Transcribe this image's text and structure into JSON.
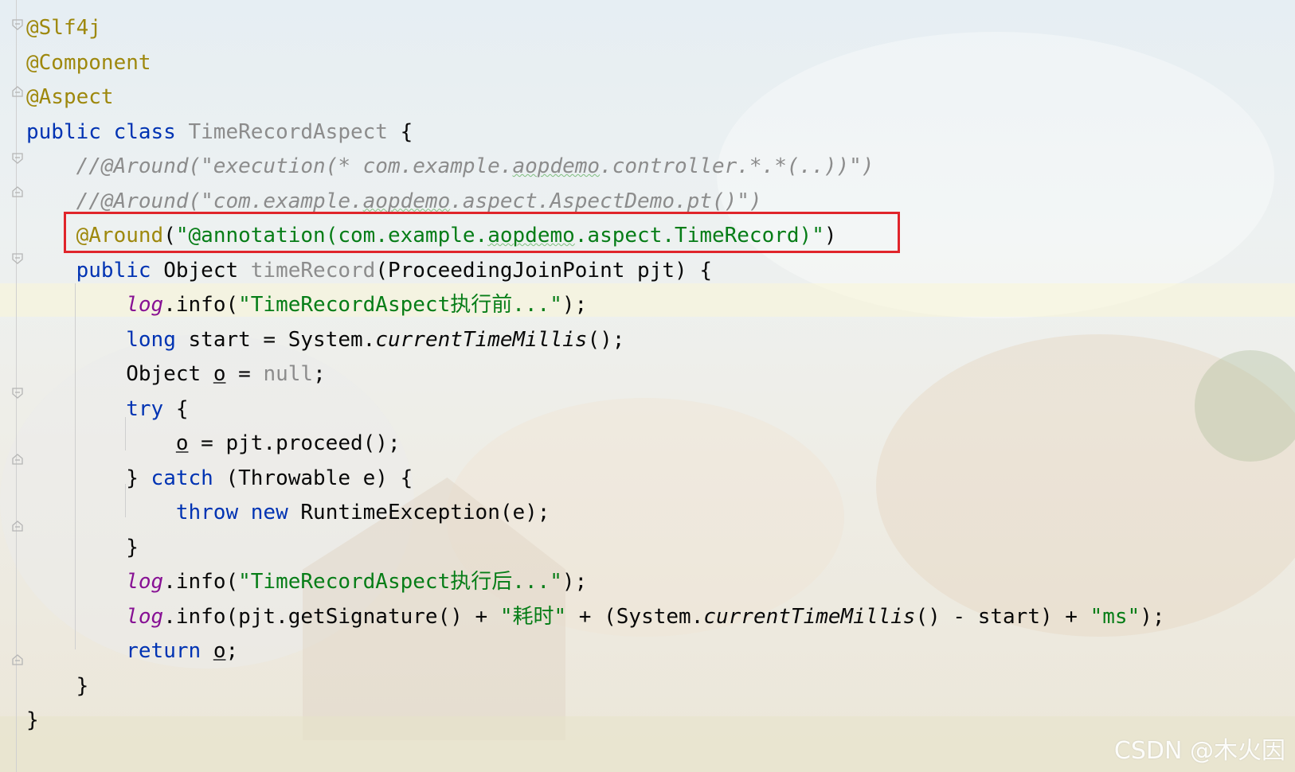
{
  "editor": {
    "lines": [
      [
        {
          "t": "@Slf4j",
          "c": "ann"
        }
      ],
      [
        {
          "t": "@Component",
          "c": "ann"
        }
      ],
      [
        {
          "t": "@Aspect",
          "c": "ann"
        }
      ],
      [
        {
          "t": "public class ",
          "c": "kw"
        },
        {
          "t": "TimeRecordAspect",
          "c": "gray"
        },
        {
          "t": " {",
          "c": ""
        }
      ],
      [
        {
          "t": "    ",
          "c": ""
        },
        {
          "t": "//@Around(\"execution(* com.example.",
          "c": "cmt"
        },
        {
          "t": "aopdemo",
          "c": "cmt wavy"
        },
        {
          "t": ".controller.*.*(..))\")",
          "c": "cmt"
        }
      ],
      [
        {
          "t": "    ",
          "c": ""
        },
        {
          "t": "//@Around(\"com.example.",
          "c": "cmt"
        },
        {
          "t": "aopdemo",
          "c": "cmt wavy"
        },
        {
          "t": ".aspect.AspectDemo.pt()\")",
          "c": "cmt"
        }
      ],
      [
        {
          "t": "    ",
          "c": ""
        },
        {
          "t": "@Around",
          "c": "ann"
        },
        {
          "t": "(",
          "c": ""
        },
        {
          "t": "\"@annotation(com.example.",
          "c": "str"
        },
        {
          "t": "aopdemo",
          "c": "str wavy"
        },
        {
          "t": ".aspect.TimeRecord)\"",
          "c": "str"
        },
        {
          "t": ")",
          "c": ""
        }
      ],
      [
        {
          "t": "    ",
          "c": ""
        },
        {
          "t": "public ",
          "c": "kw"
        },
        {
          "t": "Object ",
          "c": ""
        },
        {
          "t": "timeRecord",
          "c": "gray"
        },
        {
          "t": "(ProceedingJoinPoint pjt) {",
          "c": ""
        }
      ],
      [
        {
          "t": "        ",
          "c": ""
        },
        {
          "t": "log",
          "c": "fld"
        },
        {
          "t": ".info(",
          "c": ""
        },
        {
          "t": "\"TimeRecordAspect执行前...\"",
          "c": "str"
        },
        {
          "t": ");",
          "c": ""
        }
      ],
      [
        {
          "t": "        ",
          "c": ""
        },
        {
          "t": "long ",
          "c": "kw"
        },
        {
          "t": "start = System.",
          "c": ""
        },
        {
          "t": "currentTimeMillis",
          "c": "it"
        },
        {
          "t": "();",
          "c": ""
        }
      ],
      [
        {
          "t": "        Object ",
          "c": ""
        },
        {
          "t": "o",
          "c": "ul"
        },
        {
          "t": " = ",
          "c": ""
        },
        {
          "t": "null",
          "c": "gray"
        },
        {
          "t": ";",
          "c": ""
        }
      ],
      [
        {
          "t": "        ",
          "c": ""
        },
        {
          "t": "try ",
          "c": "kw"
        },
        {
          "t": "{",
          "c": ""
        }
      ],
      [
        {
          "t": "            ",
          "c": ""
        },
        {
          "t": "o",
          "c": "ul"
        },
        {
          "t": " = pjt.proceed();",
          "c": ""
        }
      ],
      [
        {
          "t": "        } ",
          "c": ""
        },
        {
          "t": "catch ",
          "c": "kw"
        },
        {
          "t": "(Throwable e) {",
          "c": ""
        }
      ],
      [
        {
          "t": "            ",
          "c": ""
        },
        {
          "t": "throw new ",
          "c": "kw"
        },
        {
          "t": "RuntimeException(e);",
          "c": ""
        }
      ],
      [
        {
          "t": "        }",
          "c": ""
        }
      ],
      [
        {
          "t": "        ",
          "c": ""
        },
        {
          "t": "log",
          "c": "fld"
        },
        {
          "t": ".info(",
          "c": ""
        },
        {
          "t": "\"TimeRecordAspect执行后...\"",
          "c": "str"
        },
        {
          "t": ");",
          "c": ""
        }
      ],
      [
        {
          "t": "        ",
          "c": ""
        },
        {
          "t": "log",
          "c": "fld"
        },
        {
          "t": ".info(pjt.getSignature() + ",
          "c": ""
        },
        {
          "t": "\"耗时\"",
          "c": "str"
        },
        {
          "t": " + (System.",
          "c": ""
        },
        {
          "t": "currentTimeMillis",
          "c": "it"
        },
        {
          "t": "() - start) + ",
          "c": ""
        },
        {
          "t": "\"ms\"",
          "c": "str"
        },
        {
          "t": ");",
          "c": ""
        }
      ],
      [
        {
          "t": "        ",
          "c": ""
        },
        {
          "t": "return ",
          "c": "kw"
        },
        {
          "t": "o",
          "c": "ul"
        },
        {
          "t": ";",
          "c": ""
        }
      ],
      [
        {
          "t": "    }",
          "c": ""
        }
      ],
      [
        {
          "t": "}",
          "c": ""
        }
      ]
    ]
  },
  "colors": {
    "annotation": "#9e880d",
    "keyword": "#0033b3",
    "string": "#067d17",
    "comment": "#8c8c8c",
    "field": "#871094",
    "highlight_box": "#e0252b"
  },
  "watermark": "CSDN @木火因"
}
